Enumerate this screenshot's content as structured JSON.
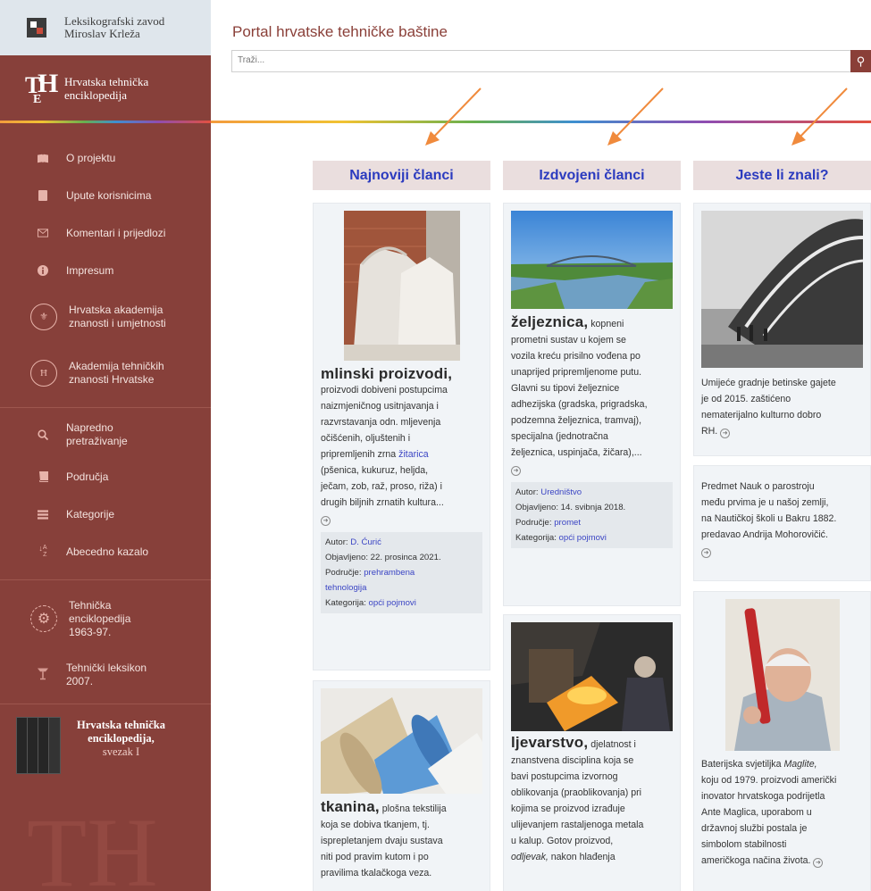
{
  "sidebar": {
    "lz_line1": "Leksikografski zavod",
    "lz_line2": "Miroslav Krleža",
    "the_line1": "Hrvatska tehnička",
    "the_line2": "enciklopedija",
    "nav": [
      {
        "icon": "book-open-icon",
        "label": "O projektu"
      },
      {
        "icon": "bookmark-icon",
        "label": "Upute korisnicima"
      },
      {
        "icon": "envelope-icon",
        "label": "Komentari i prijedlozi"
      },
      {
        "icon": "info-icon",
        "label": "Impresum"
      },
      {
        "icon": "hazu-emblem-icon",
        "label1": "Hrvatska akademija",
        "label2": "znanosti i umjetnosti"
      },
      {
        "icon": "hatz-emblem-icon",
        "label1": "Akademija tehničkih",
        "label2": "znanosti Hrvatske"
      },
      {
        "icon": "search-icon",
        "label1": "Napredno",
        "label2": "pretraživanje"
      },
      {
        "icon": "book-icon",
        "label": "Područja"
      },
      {
        "icon": "list-icon",
        "label": "Kategorije"
      },
      {
        "icon": "sort-alpha-icon",
        "label": "Abecedno kazalo"
      },
      {
        "icon": "gear-wheel-icon",
        "label1": "Tehnička",
        "label2": "enciklopedija",
        "label3": "1963-97."
      },
      {
        "icon": "lamp-icon",
        "label1": "Tehnički leksikon",
        "label2": "2007."
      }
    ],
    "book_title1": "Hrvatska tehnička",
    "book_title2": "enciklopedija,",
    "book_sub": "svezak I"
  },
  "header": {
    "title": "Portal hrvatske tehničke baštine",
    "search_placeholder": "Traži..."
  },
  "columns": {
    "newest": "Najnoviji članci",
    "featured": "Izdvojeni članci",
    "didyouknow": "Jeste li znali?"
  },
  "article1": {
    "headword": "mlinski proizvodi,",
    "lines": [
      "proizvodi dobiveni postupcima",
      "naizmjeničnog usitnjavanja i",
      "razvrstavanja odn. mljevenja",
      "očišćenih, oljuštenih i",
      "pripremljenih zrna "
    ],
    "link": "žitarica",
    "lines2": [
      "(pšenica, kukuruz, heljda,",
      "ječam, zob, raž, proso, riža) i",
      "drugih biljnih zrnatih kultura..."
    ],
    "author_label": "Autor: ",
    "author": "D. Ćurić",
    "date_label": "Objavljeno: ",
    "date": "22. prosinca 2021.",
    "field_label": "Područje: ",
    "field1": "prehrambena",
    "field2": "tehnologija",
    "cat_label": "Kategorija: ",
    "cat": "opći pojmovi"
  },
  "article2": {
    "headword": "tkanina,",
    "first": " plošna tekstilija",
    "lines": [
      "koja se dobiva tkanjem, tj.",
      "isprepletanjem dvaju sustava",
      "niti pod pravim kutom i po",
      "pravilima tkalačkoga veza."
    ]
  },
  "article3": {
    "headword": "željeznica,",
    "first": " kopneni",
    "lines": [
      "prometni sustav u kojem se",
      "vozila kreću prisilno vođena po",
      "unaprijed pripremljenome putu.",
      "Glavni su tipovi željeznice",
      "adhezijska (gradska, prigradska,",
      "podzemna željeznica, tramvaj),",
      "specijalna (jednotračna",
      "željeznica, uspinjača, žičara),..."
    ],
    "author_label": "Autor: ",
    "author": "Uredništvo",
    "date_label": "Objavljeno: ",
    "date": "14. svibnja 2018.",
    "field_label": "Područje: ",
    "field": "promet",
    "cat_label": "Kategorija: ",
    "cat": "opći pojmovi"
  },
  "article4": {
    "headword": "ljevarstvo,",
    "first": " djelatnost i",
    "lines": [
      "znanstvena disciplina koja se",
      "bavi postupcima izvornog",
      "oblikovanja (praoblikovanja) pri",
      "kojima se proizvod izrađuje",
      "ulijevanjem rastaljenoga metala",
      "u kalup. Gotov proizvod,"
    ],
    "last_italic": "odljevak,",
    "last_rest": " nakon hlađenja"
  },
  "fact1": {
    "lines": [
      "Umijeće gradnje betinske gajete",
      "je od 2015. zaštićeno",
      "nematerijalno kulturno dobro",
      "RH."
    ]
  },
  "fact2": {
    "lines": [
      "Predmet Nauk o parostroju",
      "među prvima je u našoj zemlji,",
      "na Nautičkoj školi u Bakru 1882.",
      "predavao Andrija Mohorovičić."
    ]
  },
  "fact3": {
    "l1a": "Baterijska svjetiljka ",
    "l1b": "Maglite,",
    "lines": [
      "koju od 1979. proizvodi američki",
      "inovator hrvatskoga podrijetla",
      "Ante Maglica, uporabom u",
      "državnoj službi postala je",
      "simbolom stabilnosti",
      "američkoga načina života."
    ]
  },
  "colors": {
    "sidebar": "#87403a",
    "accent": "#8a3f38",
    "link": "#2b3bbf",
    "arrow": "#f08a3c"
  }
}
